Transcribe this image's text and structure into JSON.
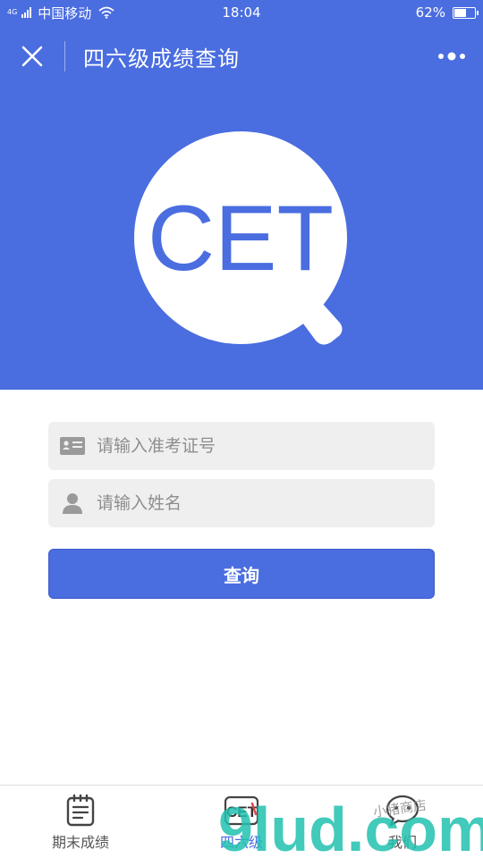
{
  "status_bar": {
    "network": "4G",
    "carrier": "中国移动",
    "time": "18:04",
    "battery_percent_label": "62%",
    "battery_level": 0.62
  },
  "title_bar": {
    "title": "四六级成绩查询"
  },
  "hero": {
    "logo_text": "CET"
  },
  "form": {
    "exam_id_placeholder": "请输入准考证号",
    "name_placeholder": "请输入姓名",
    "query_label": "查询"
  },
  "tab_bar": {
    "tabs": [
      {
        "label": "期末成绩",
        "active": false
      },
      {
        "label": "四六级",
        "active": true
      },
      {
        "label": "我们",
        "active": false
      }
    ]
  },
  "watermark": {
    "text": "9lud.com",
    "subtext": "小猪商店"
  },
  "colors": {
    "brand": "#4a6de0",
    "field_bg": "#efefef"
  }
}
